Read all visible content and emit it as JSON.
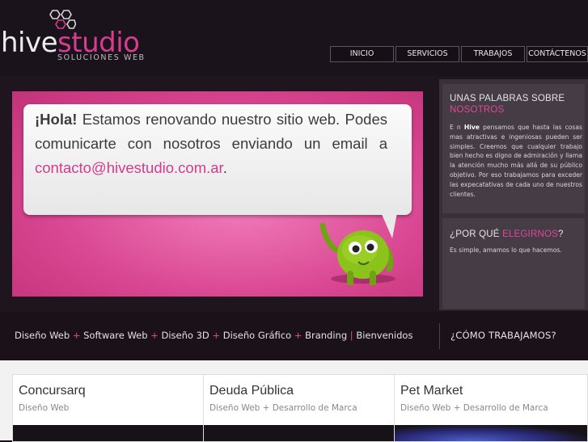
{
  "brand": {
    "name_a": "hive",
    "name_b": "studio",
    "tagline": "SOLUCIONES WEB",
    "colors": {
      "accent": "#d63d8f",
      "dark_bg": "#1a1119"
    }
  },
  "nav": {
    "items": [
      {
        "label": "INICIO"
      },
      {
        "label": "SERVICIOS"
      },
      {
        "label": "TRABAJOS"
      },
      {
        "label": "CONTÁCTENOS"
      }
    ]
  },
  "hero": {
    "greeting": "¡Hola!",
    "line1": " Estamos renovando nuestro sitio web. Podes comunicarte con nosotros enviando un email a ",
    "email": "contacto@hivestudio.com.ar",
    "end": "."
  },
  "sidebar": {
    "about_title_1": "UNAS PALABRAS SOBRE",
    "about_title_2": "NOSOTROS",
    "about_body_pre": "E n ",
    "about_body_brand": "Hive",
    "about_body_post": " pensamos que hasta las cosas mas atractivas e ingeniosas pueden ser simples. Creemos que cualquier trabajo bien hecho es digno de admiración y llama la atención mucho más allá de su público objetivo. Por eso trabajamos para exceder las expecatativas de cada uno de nuestros clientes.",
    "why_title_1": "¿POR QUÉ ",
    "why_title_2": "ELEGIRNOS",
    "why_title_3": "?",
    "why_body": "Es simple, amamos lo que hacemos."
  },
  "services": {
    "items": [
      "Diseño Web",
      "Software Web",
      "Diseño 3D",
      "Diseño Gráfico",
      "Branding",
      "Bienvenidos"
    ],
    "plus": "+",
    "bar": "|",
    "como": "¿CÓMO TRABAJAMOS?"
  },
  "works": [
    {
      "title": "Concursarq",
      "subtitle": "Diseño Web"
    },
    {
      "title": "Deuda Pública",
      "subtitle": "Diseño Web + Desarrollo de Marca"
    },
    {
      "title": "Pet Market",
      "subtitle": "Diseño Web + Desarrollo de Marca"
    }
  ]
}
